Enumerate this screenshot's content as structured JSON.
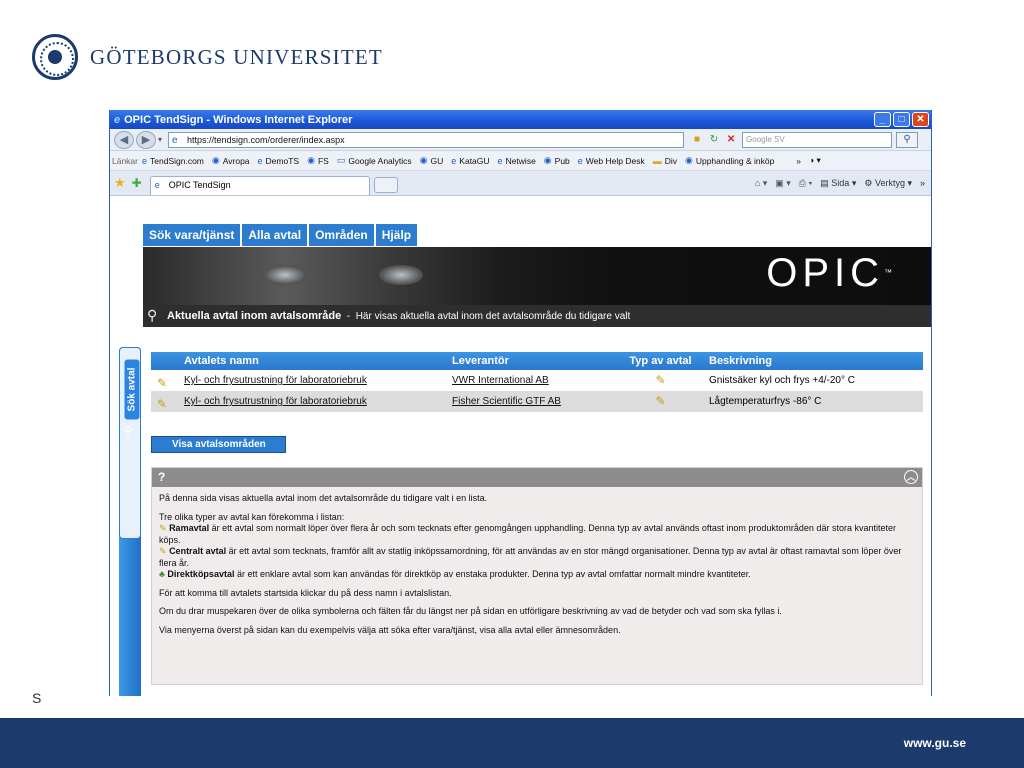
{
  "slide": {
    "university": "GÖTEBORGS UNIVERSITET",
    "corner_letter": "S",
    "footer_url": "www.gu.se"
  },
  "window": {
    "title": "OPIC TendSign - Windows Internet Explorer",
    "url": "https://tendsign.com/orderer/index.aspx",
    "search_placeholder": "Google SV",
    "links_label": "Länkar",
    "links": [
      "TendSign.com",
      "Avropa",
      "DemoTS",
      "FS",
      "Google Analytics",
      "GU",
      "KataGU",
      "Netwise",
      "Pub",
      "Web Help Desk",
      "Div",
      "Upphandling & inköp"
    ],
    "tab_title": "OPIC TendSign",
    "cmd_page": "Sida",
    "cmd_tools": "Verktyg",
    "more_glyph": "»"
  },
  "site": {
    "menu": [
      "Sök vara/tjänst",
      "Alla avtal",
      "Områden",
      "Hjälp"
    ],
    "logo": "OPIC",
    "side_tab": "Sök avtal",
    "subhead_title": "Aktuella avtal inom avtalsområde",
    "subhead_sep": "-",
    "subhead_text": "Här visas aktuella avtal inom det avtalsområde du tidigare valt"
  },
  "table": {
    "headers": [
      "Avtalets namn",
      "Leverantör",
      "Typ av avtal",
      "Beskrivning"
    ],
    "rows": [
      {
        "name": "Kyl- och frysutrustning för laboratoriebruk",
        "supplier": "VWR International AB",
        "desc": "Gnistsäker kyl och frys +4/-20° C"
      },
      {
        "name": "Kyl- och frysutrustning för laboratoriebruk",
        "supplier": "Fisher Scientific GTF AB",
        "desc": "Lågtemperaturfrys -86° C"
      }
    ]
  },
  "button_show": "Visa avtalsområden",
  "help": {
    "title": "?",
    "p1": "På denna sida visas aktuella avtal inom det avtalsområde du tidigare valt i en lista.",
    "types_intro": "Tre olika typer av avtal kan förekomma i listan:",
    "ramavtal_label": "Ramavtal",
    "ramavtal_text": " är ett avtal som normalt löper över flera år och som tecknats efter genomgången upphandling. Denna typ av avtal används oftast inom produktområden där stora kvantiteter köps.",
    "central_label": "Centralt avtal",
    "central_text": " är ett avtal som tecknats, framför allt av statlig inköpssamordning, för att användas av en stor mängd organisationer. Denna typ av avtal är oftast ramavtal som löper över flera år.",
    "direkt_label": "Direktköpsavtal",
    "direkt_text": " är ett enklare avtal som kan användas för direktköp av enstaka produkter. Denna typ av avtal omfattar normalt mindre kvantiteter.",
    "p3": "För att komma till avtalets startsida klickar du på dess namn i avtalslistan.",
    "p4": "Om du drar muspekaren över de olika symbolerna och fälten får du längst ner på sidan en utförligare beskrivning av vad de betyder och vad som ska fyllas i.",
    "p5": "Via menyerna överst på sidan kan du exempelvis välja att söka efter vara/tjänst, visa alla avtal eller ämnesområden."
  }
}
